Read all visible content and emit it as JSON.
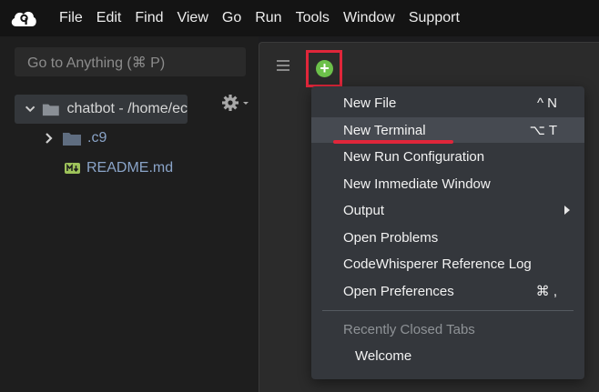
{
  "menubar": {
    "logo_icon": "cloud9-logo-icon",
    "items": [
      "File",
      "Edit",
      "Find",
      "View",
      "Go",
      "Run",
      "Tools",
      "Window",
      "Support"
    ]
  },
  "left_panel": {
    "goto_placeholder": "Go to Anything (⌘ P)",
    "gear_icon": "gear-icon",
    "tree": {
      "root_label": "chatbot - /home/ec",
      "children": [
        {
          "label": ".c9",
          "icon": "folder-icon"
        },
        {
          "label": "README.md",
          "icon": "markdown-file-icon"
        }
      ]
    }
  },
  "editor": {
    "hamburger_icon": "hamburger-menu-icon",
    "add_icon": "plus-circle-icon",
    "highlight_color": "#e0263a"
  },
  "dropdown": {
    "items": [
      {
        "label": "New File",
        "shortcut": "^ N"
      },
      {
        "label": "New Terminal",
        "shortcut": "⌥ T"
      },
      {
        "label": "New Run Configuration",
        "shortcut": ""
      },
      {
        "label": "New Immediate Window",
        "shortcut": ""
      },
      {
        "label": "Output",
        "shortcut": ""
      },
      {
        "label": "Open Problems",
        "shortcut": ""
      },
      {
        "label": "CodeWhisperer Reference Log",
        "shortcut": ""
      },
      {
        "label": "Open Preferences",
        "shortcut": "⌘ ,"
      }
    ],
    "section_title": "Recently Closed Tabs",
    "recent": [
      "Welcome"
    ]
  }
}
